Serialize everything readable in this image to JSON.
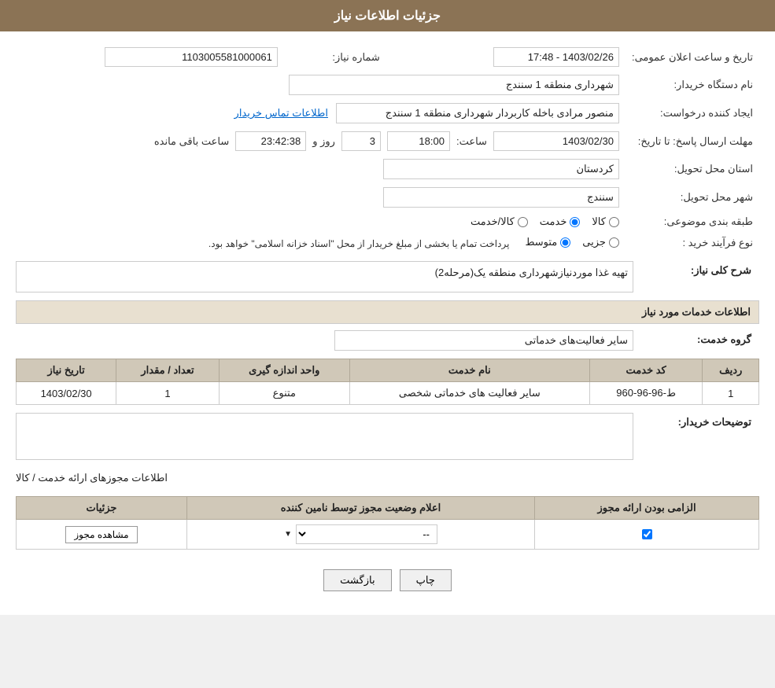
{
  "page": {
    "title": "جزئیات اطلاعات نیاز"
  },
  "header": {
    "label": "شماره نیاز:",
    "id_value": "1103005581000061",
    "buyer_org_label": "نام دستگاه خریدار:",
    "buyer_org_value": "شهرداری منطقه 1 سنندج",
    "requester_label": "ایجاد کننده درخواست:",
    "requester_value": "منصور مرادی باخله کاربردار شهرداری منطقه 1 سنندج",
    "contact_link": "اطلاعات تماس خریدار",
    "deadline_label": "مهلت ارسال پاسخ: تا تاریخ:",
    "deadline_date": "1403/02/30",
    "deadline_time_label": "ساعت:",
    "deadline_time": "18:00",
    "days_remaining_label": "روز و",
    "days_remaining": "3",
    "hours_remaining": "23:42:38",
    "hours_remaining_label": "ساعت باقی مانده",
    "announce_label": "تاریخ و ساعت اعلان عمومی:",
    "announce_value": "1403/02/26 - 17:48",
    "province_label": "استان محل تحویل:",
    "province_value": "کردستان",
    "city_label": "شهر محل تحویل:",
    "city_value": "سنندج",
    "category_label": "طبقه بندی موضوعی:",
    "category_kala": "کالا",
    "category_khadamat": "خدمت",
    "category_kala_khadamat": "کالا/خدمت",
    "purchase_type_label": "نوع فرآیند خرید :",
    "purchase_type_jazee": "جزیی",
    "purchase_type_motawaset": "متوسط",
    "purchase_type_note": "پرداخت تمام یا بخشی از مبلغ خریدار از محل \"اسناد خزانه اسلامی\" خواهد بود."
  },
  "need_summary": {
    "label": "شرح کلی نیاز:",
    "value": "تهیه غذا موردنیازشهرداری منطقه یک(مرحله2)"
  },
  "services_info": {
    "title": "اطلاعات خدمات مورد نیاز",
    "service_group_label": "گروه خدمت:",
    "service_group_value": "سایر فعالیت‌های خدماتی",
    "table": {
      "headers": [
        "ردیف",
        "کد خدمت",
        "نام خدمت",
        "واحد اندازه گیری",
        "تعداد / مقدار",
        "تاریخ نیاز"
      ],
      "rows": [
        {
          "row": "1",
          "code": "ط-96-96-960",
          "name": "سایر فعالیت های خدماتی شخصی",
          "unit": "متنوع",
          "qty": "1",
          "date": "1403/02/30"
        }
      ]
    }
  },
  "buyer_desc": {
    "label": "توضیحات خریدار:",
    "value": ""
  },
  "permit_section": {
    "title": "اطلاعات مجوزهای ارائه خدمت / کالا",
    "table": {
      "headers": [
        "الزامی بودن ارائه مجوز",
        "اعلام وضعیت مجوز توسط نامین کننده",
        "جزئیات"
      ],
      "rows": [
        {
          "required": true,
          "status": "--",
          "details_btn": "مشاهده مجوز"
        }
      ]
    }
  },
  "buttons": {
    "print": "چاپ",
    "back": "بازگشت"
  }
}
